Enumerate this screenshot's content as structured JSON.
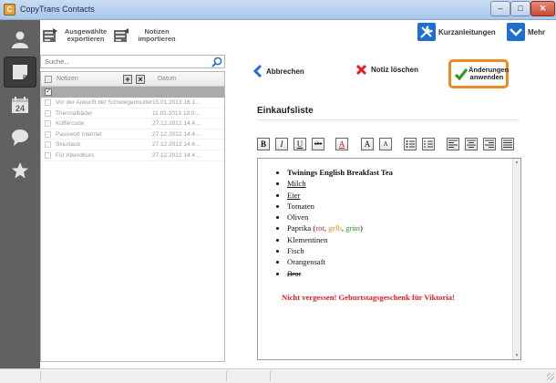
{
  "window": {
    "title": "CopyTrans Contacts",
    "icon_letter": "C"
  },
  "nav": {
    "items": [
      {
        "name": "contacts",
        "icon": "person-icon"
      },
      {
        "name": "notes",
        "icon": "note-icon",
        "active": true
      },
      {
        "name": "calendar",
        "icon": "calendar-icon",
        "day": "24"
      },
      {
        "name": "messages",
        "icon": "speech-bubble-icon"
      },
      {
        "name": "favorites",
        "icon": "star-icon"
      }
    ]
  },
  "toolbar": {
    "export_label": "Ausgewählte exportieren",
    "import_label": "Notizen importieren",
    "guides_label": "Kurzanleitungen",
    "more_label": "Mehr"
  },
  "search": {
    "placeholder": "Suche..."
  },
  "notes_list": {
    "header_notes": "Notizen",
    "header_date": "Datum",
    "rows": [
      {
        "title": "Vor der Ankunft der Schwiegermutter",
        "date": "15.01.2013 16:1..."
      },
      {
        "title": "Thermalbäder",
        "date": "11.01.2013 19:0..."
      },
      {
        "title": "Koffercode",
        "date": "27.12.2012 14:4..."
      },
      {
        "title": "Passwort Internet",
        "date": "27.12.2012 14:4..."
      },
      {
        "title": "Skiurlaub",
        "date": "27.12.2012 14:4..."
      },
      {
        "title": "Für Abendkurs",
        "date": "27.12.2012 14:4..."
      }
    ]
  },
  "actions": {
    "cancel_label": "Abbrechen",
    "delete_label": "Notiz löschen",
    "apply_label": "Änderungen anwenden"
  },
  "note": {
    "title": "Einkaufsliste",
    "items": {
      "i1": "Twinings English Breakfast Tea",
      "i2": "Milch",
      "i3": "Eier",
      "i4": "Tomaten",
      "i5": "Oliven",
      "i6_pre": "Paprika (",
      "i6_rot": "rot",
      "i6_gelb": "gelb",
      "i6_gruen": "grün",
      "i6_post": ")",
      "i7": "Klementinen",
      "i8": "Fisch",
      "i9": "Orangensaft",
      "i10": "Brot"
    },
    "reminder": "Nicht vergessen! Geburtstagsgeschenk für Viktoria!"
  },
  "format_toolbar": {
    "bold": "B",
    "italic": "I",
    "underline": "U",
    "strike": "abc",
    "color": "A",
    "grow": "A",
    "shrink": "A"
  },
  "colors": {
    "accent_orange": "#f08a1e",
    "nav_bg": "#616161",
    "red_text": "#e02020",
    "green_text": "#2a9a2a"
  }
}
